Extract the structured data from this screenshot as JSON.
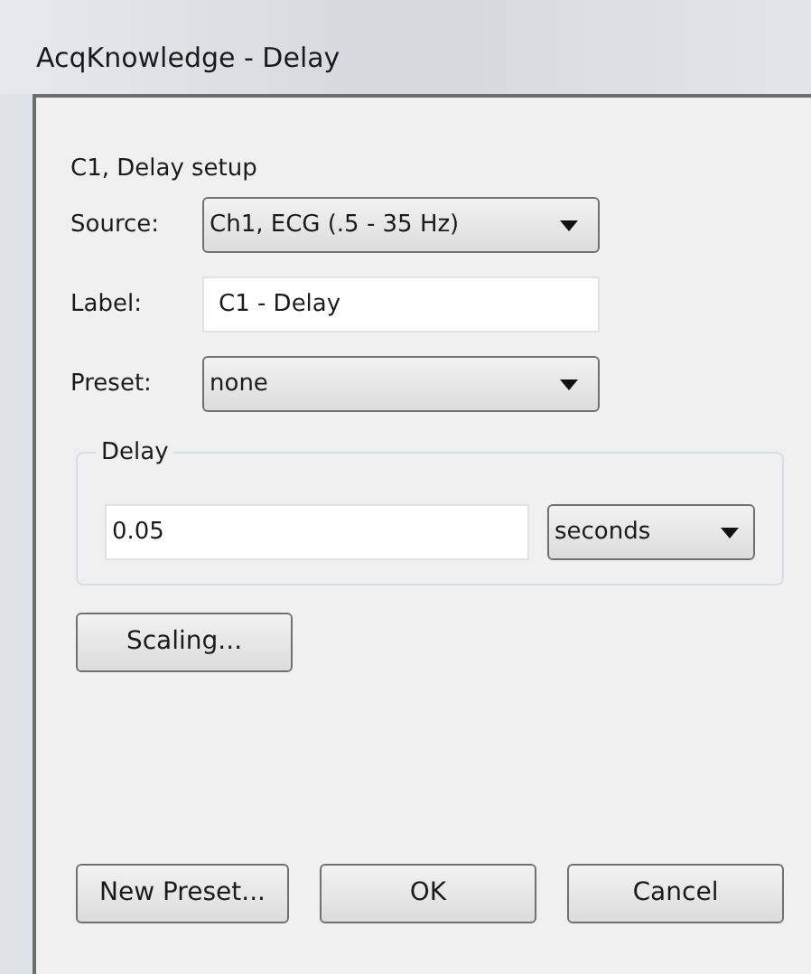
{
  "window": {
    "title": "AcqKnowledge - Delay"
  },
  "heading": "C1, Delay setup",
  "source": {
    "label": "Source:",
    "value": "Ch1, ECG (.5 - 35 Hz)"
  },
  "label_field": {
    "label": "Label:",
    "value": "C1 - Delay"
  },
  "preset": {
    "label": "Preset:",
    "value": "none"
  },
  "delay_group": {
    "title": "Delay",
    "value": "0.05",
    "unit": "seconds"
  },
  "scaling_button": "Scaling...",
  "buttons": [
    "New Preset...",
    "OK",
    "Cancel"
  ]
}
